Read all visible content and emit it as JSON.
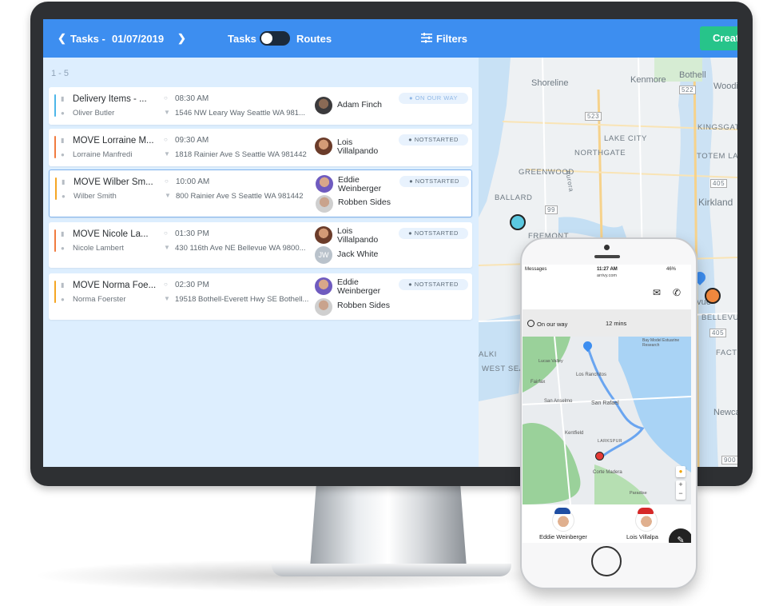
{
  "topbar": {
    "tasks_label": "Tasks -",
    "date": "01/07/2019",
    "toggle_left": "Tasks",
    "toggle_right": "Routes",
    "filters_label": "Filters",
    "create_label": "Creat"
  },
  "list": {
    "range": "1 - 5",
    "rows": [
      {
        "title": "Delivery Items - ...",
        "customer": "Oliver Butler",
        "time": "08:30 AM",
        "address": "1546 NW Leary Way Seattle WA 981...",
        "assignee1": "Adam Finch",
        "assignee2": "",
        "status": "ON OUR WAY",
        "bar_color": "#4db6e8"
      },
      {
        "title": "MOVE Lorraine M...",
        "customer": "Lorraine Manfredi",
        "time": "09:30 AM",
        "address": "1818 Rainier Ave S Seattle WA 981442",
        "assignee1": "Lois Villalpando",
        "assignee2": "",
        "status": "NOTSTARTED",
        "bar_color": "#f07b3f"
      },
      {
        "title": "MOVE Wilber Sm...",
        "customer": "Wilber Smith",
        "time": "10:00 AM",
        "address": "800 Rainier Ave S Seattle WA 981442",
        "assignee1": "Eddie Weinberger",
        "assignee2": "Robben Sides",
        "status": "NOTSTARTED",
        "bar_color": "#f5a623"
      },
      {
        "title": "MOVE Nicole La...",
        "customer": "Nicole Lambert",
        "time": "01:30 PM",
        "address": "430 116th Ave NE Bellevue WA 9800...",
        "assignee1": "Lois Villalpando",
        "assignee2": "Jack White",
        "assignee2_initials": "JW",
        "status": "NOTSTARTED",
        "bar_color": "#f07b3f"
      },
      {
        "title": "MOVE Norma Foe...",
        "customer": "Norma Foerster",
        "time": "02:30 PM",
        "address": "19518 Bothell-Everett Hwy SE Bothell...",
        "assignee1": "Eddie Weinberger",
        "assignee2": "Robben Sides",
        "status": "NOTSTARTED",
        "bar_color": "#f5a623"
      }
    ]
  },
  "map": {
    "labels": {
      "shoreline": "Shoreline",
      "kenmore": "Kenmore",
      "bothell": "Bothell",
      "woodi": "Woodi",
      "kingsgate": "KINGSGATE",
      "totem_lake": "TOTEM LAK",
      "lake_city": "LAKE CITY",
      "northgate": "NORTHGATE",
      "greenwood": "GREENWOOD",
      "ballard": "BALLARD",
      "kirkland": "Kirkland",
      "fremont": "FREMONT",
      "bellevue": "BELLEVUE",
      "evue": "evue",
      "facto": "FACTO",
      "alki": "ALKI",
      "west_seat": "WEST SEAT",
      "newca": "Newca",
      "hwy522": "522",
      "hwy523": "523",
      "hwy405a": "405",
      "hwy405b": "405",
      "hwy99": "99",
      "hwy900": "900",
      "aurora": "Aurora"
    },
    "pin_colors": {
      "cyan": "#5bc8e0",
      "orange": "#f0883e",
      "blue": "#3d8ef0"
    }
  },
  "phone": {
    "status_left": "Messages",
    "status_time": "11:27 AM",
    "status_right": "46%",
    "url": "arrivy.com",
    "status_text": "On our way",
    "eta": "12 mins",
    "map_labels": {
      "los_ranchitos": "Los Ranchitos",
      "fairfax": "Fairfax",
      "san_anselmo": "San Anselmo",
      "san_rafael": "San Rafael",
      "kentfield": "Kentfield",
      "larkspur": "LARKSPUR",
      "corte_madera": "Corte Madera",
      "paradise": "Paradise",
      "bay_model": "Bay Model Estuarine Research",
      "lucas_valley": "Lucas Valley"
    },
    "contacts": [
      "Eddie Weinberger",
      "Lois Villalpa"
    ]
  }
}
